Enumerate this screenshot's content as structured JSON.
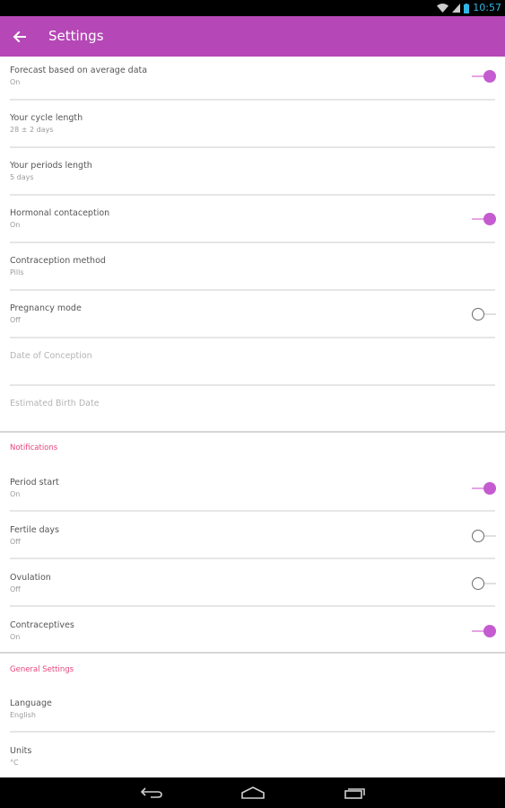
{
  "status_bar": {
    "time": "10:57"
  },
  "app_bar": {
    "title": "Settings"
  },
  "settings": [
    {
      "label": "Forecast based on average data",
      "value": "On",
      "toggle": "on"
    },
    {
      "label": "Your cycle length",
      "value": "28 ± 2 days"
    },
    {
      "label": "Your periods length",
      "value": "5 days"
    },
    {
      "label": "Hormonal contaception",
      "value": "On",
      "toggle": "on"
    },
    {
      "label": "Contraception method",
      "value": "Pills"
    },
    {
      "label": "Pregnancy mode",
      "value": "Off",
      "toggle": "off"
    },
    {
      "label": "Date of Conception",
      "value": ""
    },
    {
      "label": "Estimated Birth Date",
      "value": ""
    }
  ],
  "notifications": {
    "header": "Notifications",
    "items": [
      {
        "label": "Period start",
        "value": "On",
        "toggle": "on"
      },
      {
        "label": "Fertile days",
        "value": "Off",
        "toggle": "off"
      },
      {
        "label": "Ovulation",
        "value": "Off",
        "toggle": "off"
      },
      {
        "label": "Contraceptives",
        "value": "On",
        "toggle": "on"
      }
    ]
  },
  "general": {
    "header": "General Settings",
    "items": [
      {
        "label": "Language",
        "value": "English"
      },
      {
        "label": "Units",
        "value": "°C"
      }
    ]
  },
  "colors": {
    "accent": "#b547b6",
    "section_header": "#e8457a",
    "toggle_on": "#c55bd0"
  }
}
